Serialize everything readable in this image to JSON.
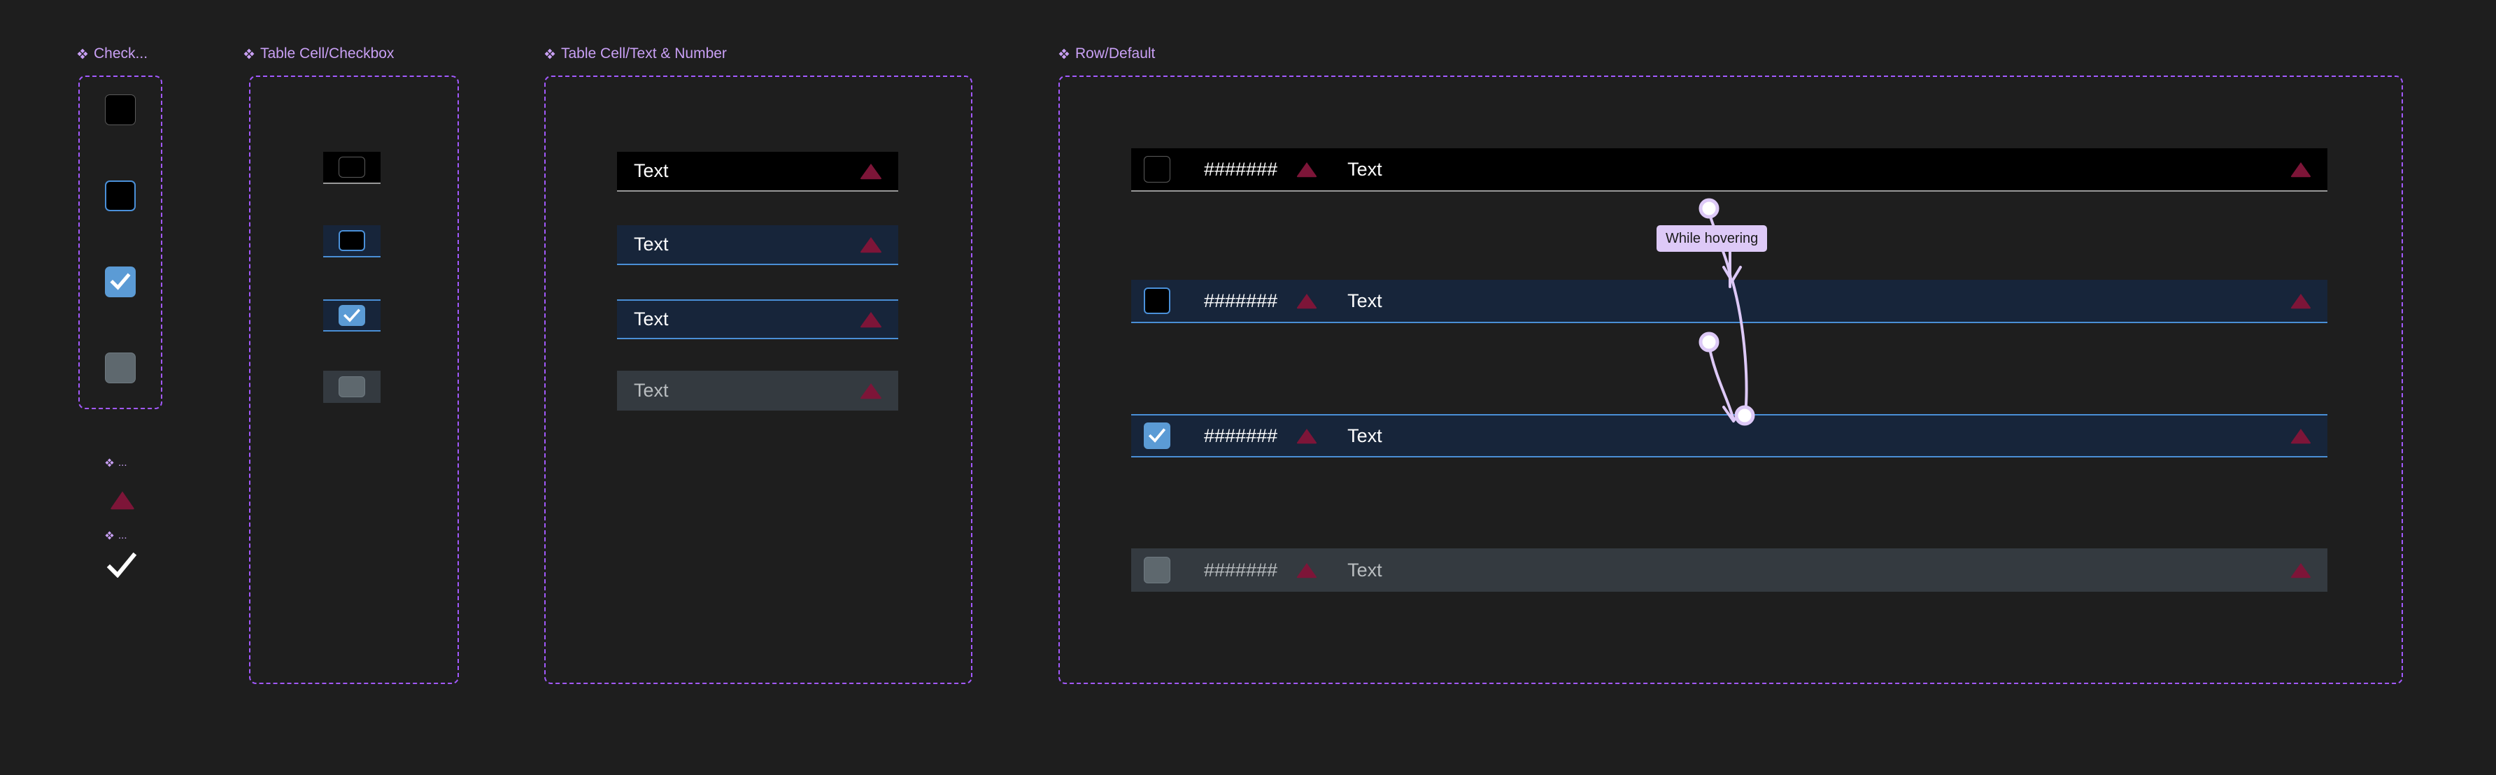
{
  "canvas": {
    "background": "#1e1e1e",
    "accent_purple": "#a259ff",
    "label_purple": "#c9a0f5",
    "blue_accent": "#5b9bd5",
    "blue_border": "#4a8fd6",
    "row_hover_bg": "#17253a",
    "row_default_bg": "#000000",
    "row_disabled_bg": "#343a40",
    "triangle_crimson": "#7d1538",
    "proto_pink": "#ddc9f7"
  },
  "component_sets": [
    {
      "id": "checkbox",
      "label": "Check...",
      "icon": "component-set-diamond-icon"
    },
    {
      "id": "cell_checkbox",
      "label": "Table Cell/Checkbox",
      "icon": "component-set-diamond-icon"
    },
    {
      "id": "cell_text",
      "label": "Table Cell/Text & Number",
      "icon": "component-set-diamond-icon"
    },
    {
      "id": "row_default",
      "label": "Row/Default",
      "icon": "component-set-diamond-icon"
    }
  ],
  "checkbox_variants": [
    {
      "state": "default",
      "checked": false,
      "label_state": "Default"
    },
    {
      "state": "hover",
      "checked": false,
      "label_state": "Hover"
    },
    {
      "state": "checked",
      "checked": true,
      "label_state": "Checked"
    },
    {
      "state": "disabled",
      "checked": false,
      "label_state": "Disabled"
    }
  ],
  "cell_checkbox_variants": [
    {
      "state": "default"
    },
    {
      "state": "hover"
    },
    {
      "state": "selected"
    },
    {
      "state": "disabled"
    }
  ],
  "cell_text_variants": [
    {
      "state": "default",
      "text": "Text",
      "icon": "triangle-up-icon"
    },
    {
      "state": "hover",
      "text": "Text",
      "icon": "triangle-up-icon"
    },
    {
      "state": "selected",
      "text": "Text",
      "icon": "triangle-up-icon"
    },
    {
      "state": "disabled",
      "text": "Text",
      "icon": "triangle-up-icon"
    }
  ],
  "rows": [
    {
      "state": "default",
      "checked": false,
      "number": "#######",
      "icon": "triangle-up-icon",
      "text": "Text",
      "trailing_icon": "triangle-up-icon"
    },
    {
      "state": "hover",
      "checked": false,
      "number": "#######",
      "icon": "triangle-up-icon",
      "text": "Text",
      "trailing_icon": "triangle-up-icon"
    },
    {
      "state": "selected",
      "checked": true,
      "number": "#######",
      "icon": "triangle-up-icon",
      "text": "Text",
      "trailing_icon": "triangle-up-icon"
    },
    {
      "state": "disabled",
      "checked": false,
      "number": "#######",
      "icon": "triangle-up-icon",
      "text": "Text",
      "trailing_icon": "triangle-up-icon"
    }
  ],
  "prototype": {
    "interactions": [
      {
        "trigger": "While hovering",
        "from": "row-default",
        "to": "row-hover"
      },
      {
        "trigger": "",
        "from": "row-hover",
        "to": "row-selected"
      }
    ],
    "pill_label": "While hovering"
  },
  "mini_instances": [
    {
      "label": "...",
      "icon": "triangle-up-icon",
      "icon_name": "triangle-up-icon"
    },
    {
      "label": "...",
      "icon": "check-icon",
      "icon_name": "check-icon"
    }
  ]
}
